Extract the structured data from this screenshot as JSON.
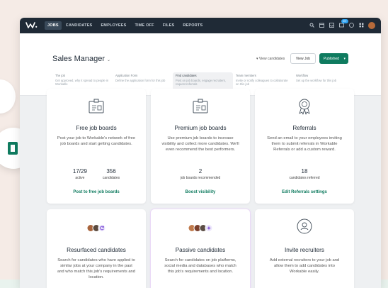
{
  "nav": {
    "items": [
      "JOBS",
      "CANDIDATES",
      "EMPLOYEES",
      "TIME OFF",
      "FILES",
      "REPORTS"
    ],
    "badge": "99+"
  },
  "job": {
    "title": "Sales Manager",
    "view_candidates": "View candidates",
    "view_job": "View Job",
    "published": "Published"
  },
  "steps": [
    {
      "title": "The job",
      "text": "Get approved, why it spread to people in Workable"
    },
    {
      "title": "Application Form",
      "text": "Define the application form for this job"
    },
    {
      "title": "Find candidates",
      "text": "Post on job boards, engage recruiters, request referrals"
    },
    {
      "title": "Team members",
      "text": "Invite or notify colleagues to collaborate on this job"
    },
    {
      "title": "Workflow",
      "text": "Set up the workflow for this job"
    }
  ],
  "cards": {
    "free": {
      "title": "Free job boards",
      "desc": "Post your job to Workable's network of free job boards and start getting candidates.",
      "stat1_n": "17/29",
      "stat1_l": "active",
      "stat2_n": "356",
      "stat2_l": "candidates",
      "link": "Post to free job boards"
    },
    "premium": {
      "title": "Premium job boards",
      "desc": "Use premium job boards to increase visibility and collect more candidates. We'll even recommend the best performers.",
      "stat_n": "2",
      "stat_l": "job boards recommended",
      "link": "Boost visibility"
    },
    "referrals": {
      "title": "Referrals",
      "desc": "Send an email to your employees inviting them to submit referrals in Workable Referrals or add a custom reward.",
      "stat_n": "18",
      "stat_l": "candidates referred",
      "link": "Edit Referrals settings"
    },
    "resurfaced": {
      "title": "Resurfaced candidates",
      "desc": "Search for candidates who have applied to similar jobs at your company in the past and who match this job's requirements and location."
    },
    "passive": {
      "title": "Passive candidates",
      "desc": "Search for candidates on job platforms, social media and databases who match this job's requirements and location."
    },
    "invite": {
      "title": "Invite recruiters",
      "desc": "Add external recruiters to your job and allow them to add candidates into Workable easily."
    }
  },
  "colors": {
    "accent": "#0f7b5f",
    "nav_bg": "#1f2a36",
    "page_bg": "#f5ebe6"
  }
}
